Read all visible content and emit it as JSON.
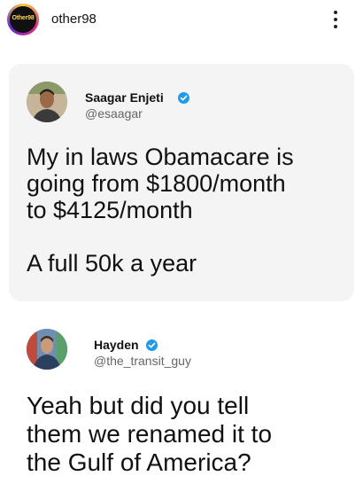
{
  "post": {
    "author_avatar_text": "Other98",
    "author": "other98"
  },
  "tweets": [
    {
      "name": "Saagar Enjeti",
      "handle": "@esaagar",
      "text": "My in laws Obamacare is\ngoing from $1800/month\nto $4125/month\n\nA full 50k a year"
    },
    {
      "name": "Hayden",
      "handle": "@the_transit_guy",
      "text": "Yeah but did you tell\nthem we renamed it to\nthe Gulf of America?"
    }
  ],
  "icons": {
    "more": "more-vertical-icon",
    "verified": "verified-badge-icon"
  },
  "colors": {
    "verified": "#1d9bf0",
    "card_bg": "#f4f4f5"
  }
}
